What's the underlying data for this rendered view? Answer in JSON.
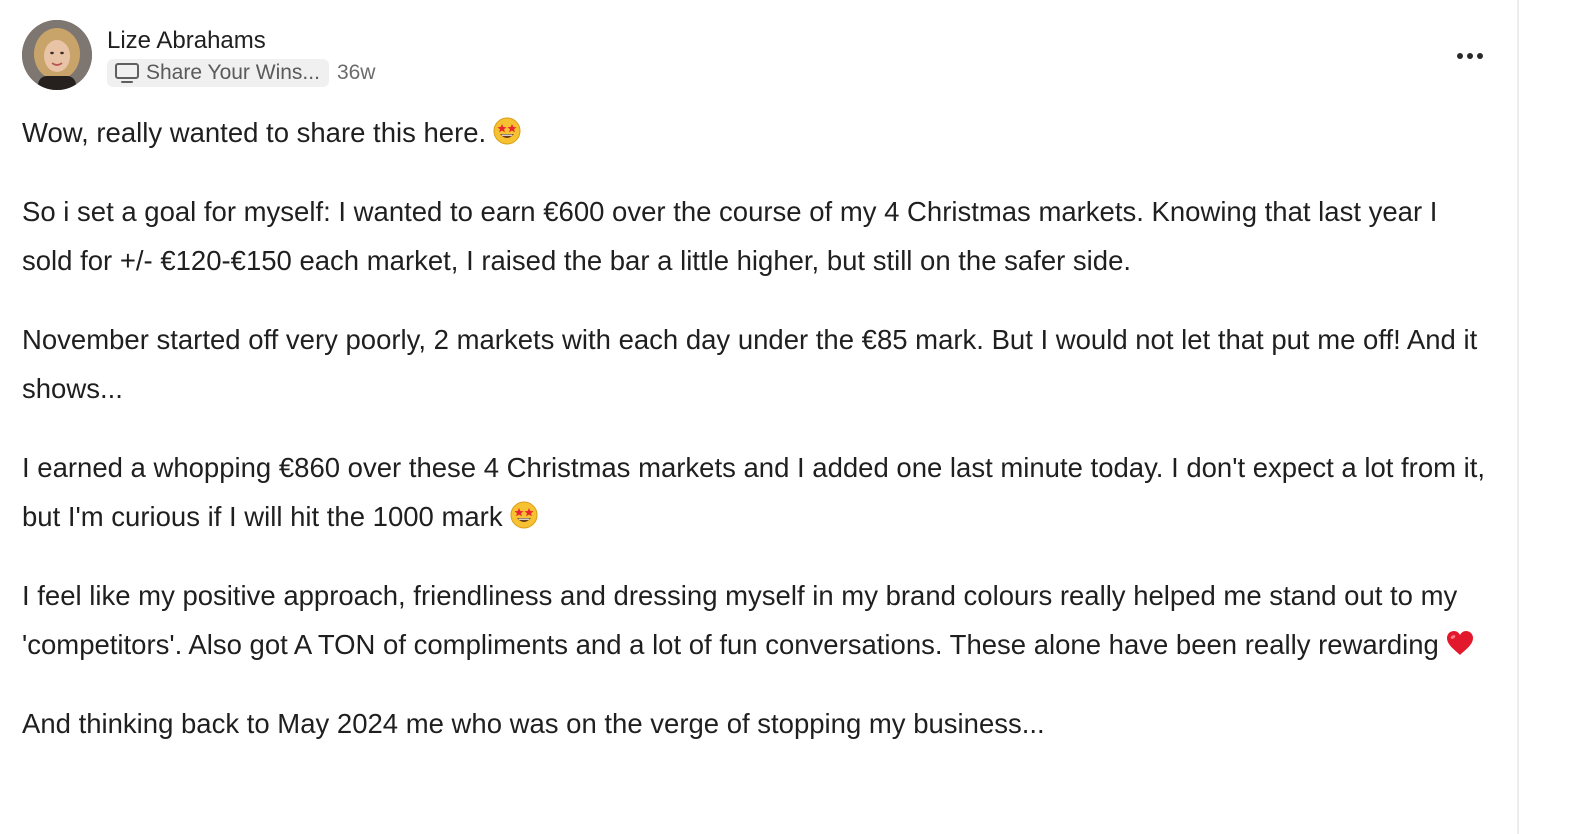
{
  "post": {
    "author": "Lize Abrahams",
    "category": "Share Your Wins...",
    "age": "36w",
    "paragraphs": [
      "Wow, really wanted to share this here.",
      "So i set a goal for myself: I wanted to earn €600 over the course of my 4 Christmas markets. Knowing that last year I sold for +/- €120-€150 each market, I raised the bar a little higher, but still on the safer side.",
      "November started off very poorly, 2 markets with each day under the €85 mark. But I would not let that put me off! And it shows...",
      "I earned a whopping €860 over these 4 Christmas markets and I added one last minute today. I don't expect a lot from it, but I'm curious if I will hit the 1000 mark",
      "I feel like my positive approach, friendliness and dressing myself in my brand colours really helped me stand out to my 'competitors'. Also got A TON of compliments and a lot of fun conversations. These alone have been really rewarding",
      "And thinking back to May 2024 me who was on the verge of stopping my business..."
    ]
  },
  "icons": {
    "category": "monitor-icon",
    "menu": "more-options-icon",
    "emoji_star": "star-struck-emoji",
    "emoji_heart": "red-heart-emoji"
  }
}
